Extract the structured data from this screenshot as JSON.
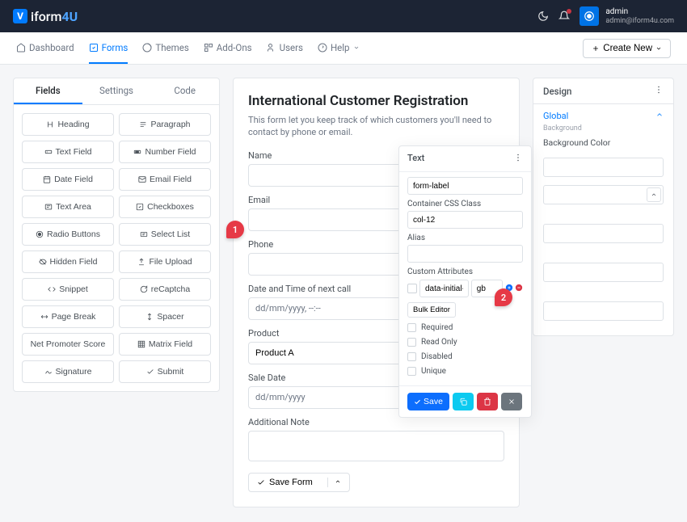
{
  "brand": {
    "mark": "V",
    "name": "iform",
    "suffix": "4U"
  },
  "topbar": {
    "admin_name": "admin",
    "admin_email": "admin@iform4u.com"
  },
  "nav": {
    "items": [
      "Dashboard",
      "Forms",
      "Themes",
      "Add-Ons",
      "Users",
      "Help"
    ],
    "create": "Create New"
  },
  "left": {
    "tabs": [
      "Fields",
      "Settings",
      "Code"
    ],
    "fields": [
      "Heading",
      "Paragraph",
      "Text Field",
      "Number Field",
      "Date Field",
      "Email Field",
      "Text Area",
      "Checkboxes",
      "Radio Buttons",
      "Select List",
      "Hidden Field",
      "File Upload",
      "Snippet",
      "reCaptcha",
      "Page Break",
      "Spacer",
      "Net Promoter Score",
      "Matrix Field",
      "Signature",
      "Submit"
    ]
  },
  "form": {
    "title": "International Customer Registration",
    "desc": "This form let you keep track of which customers you'll need to contact by phone or email.",
    "labels": {
      "name": "Name",
      "email": "Email",
      "phone": "Phone",
      "datetime": "Date and Time of next call",
      "product": "Product",
      "sale_date": "Sale Date",
      "note": "Additional Note"
    },
    "values": {
      "datetime_placeholder": "dd/mm/yyyy, --:--",
      "product": "Product A",
      "sale_date_placeholder": "dd/mm/yyyy"
    },
    "save": "Save Form"
  },
  "right": {
    "header": "Design",
    "section": "Global",
    "subtitle": "Background",
    "label1": "Background Color"
  },
  "popover": {
    "header": "Text",
    "label_css": {
      "value": "form-label"
    },
    "container_label": "Container CSS Class",
    "container_value": "col-12",
    "alias_label": "Alias",
    "custom_attr_label": "Custom Attributes",
    "attr_key": "data-initial-",
    "attr_val": "gb",
    "bulk": "Bulk Editor",
    "checks": [
      "Required",
      "Read Only",
      "Disabled",
      "Unique"
    ],
    "save": "Save"
  },
  "callouts": {
    "one": "1",
    "two": "2"
  }
}
